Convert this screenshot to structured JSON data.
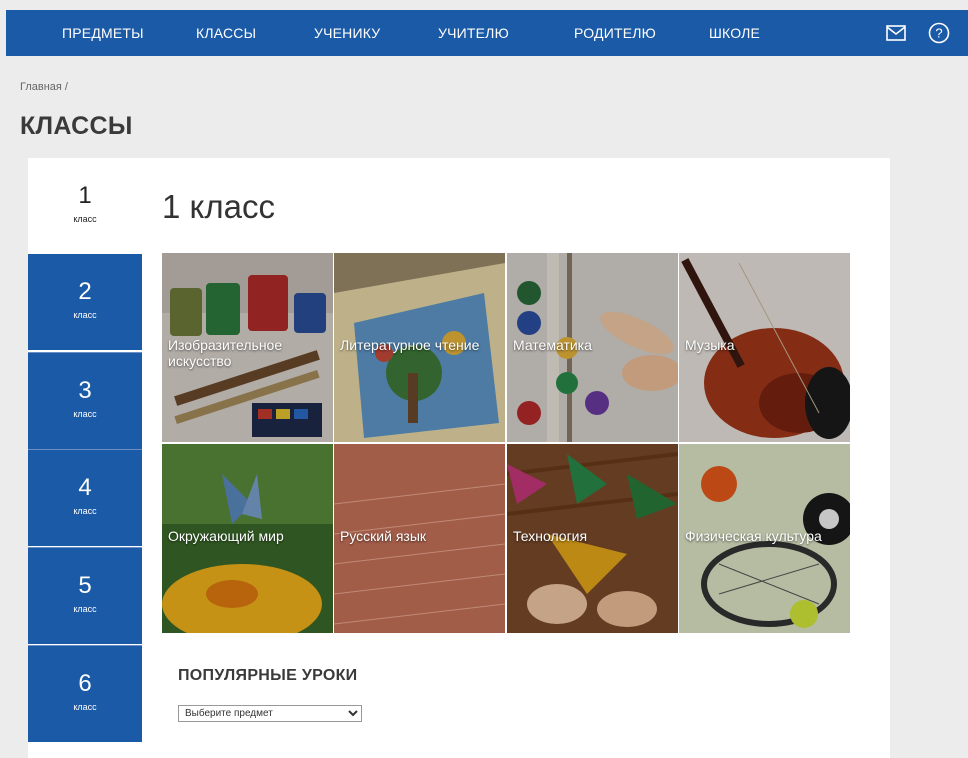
{
  "nav": {
    "items": [
      "ПРЕДМЕТЫ",
      "КЛАССЫ",
      "УЧЕНИКУ",
      "УЧИТЕЛЮ",
      "РОДИТЕЛЮ",
      "ШКОЛЕ"
    ],
    "mail_icon": "mail-icon",
    "help_icon": "help-icon"
  },
  "breadcrumb": "Главная /",
  "page_title": "КЛАССЫ",
  "classes": {
    "items": [
      {
        "number": "1",
        "label": "класс"
      },
      {
        "number": "2",
        "label": "класс"
      },
      {
        "number": "3",
        "label": "класс"
      },
      {
        "number": "4",
        "label": "класс"
      },
      {
        "number": "5",
        "label": "класс"
      },
      {
        "number": "6",
        "label": "класс"
      }
    ],
    "active": "1"
  },
  "grade_title": "1 класс",
  "subjects": [
    {
      "name": "Изобразительное искусство"
    },
    {
      "name": "Литературное чтение"
    },
    {
      "name": "Математика"
    },
    {
      "name": "Музыка"
    },
    {
      "name": "Окружающий мир"
    },
    {
      "name": "Русский язык"
    },
    {
      "name": "Технология"
    },
    {
      "name": "Физическая культура"
    }
  ],
  "popular": {
    "title": "ПОПУЛЯРНЫЕ УРОКИ",
    "select_value": "Выберите предмет"
  },
  "colors": {
    "brand_blue": "#1b5aa6",
    "page_bg": "#ececec"
  }
}
